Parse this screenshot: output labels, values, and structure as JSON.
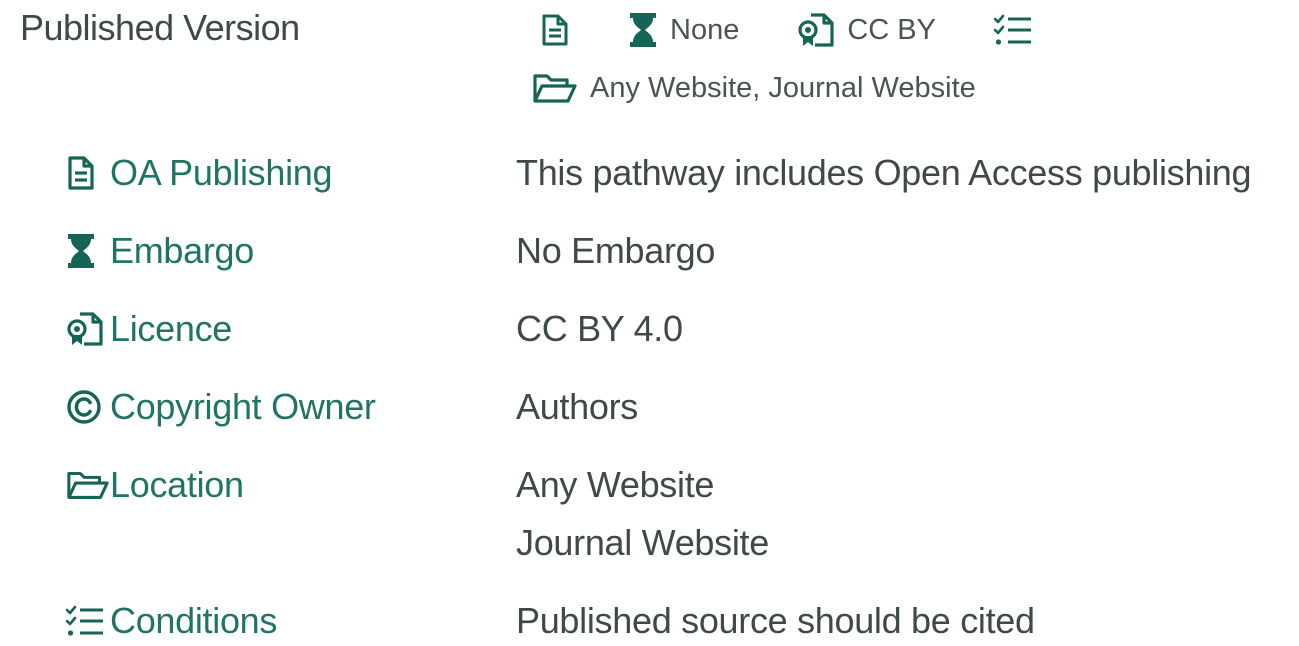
{
  "title": "Published Version",
  "summary": {
    "embargo": "None",
    "licence": "CC BY",
    "location": "Any Website, Journal Website"
  },
  "details": {
    "oa_publishing": {
      "label": "OA Publishing",
      "icon": "document-icon",
      "value": "This pathway includes Open Access publishing"
    },
    "embargo": {
      "label": "Embargo",
      "icon": "hourglass-icon",
      "value": "No Embargo"
    },
    "licence": {
      "label": "Licence",
      "icon": "certificate-icon",
      "value": "CC BY 4.0"
    },
    "copyright": {
      "label": "Copyright Owner",
      "icon": "copyright-icon",
      "value": "Authors"
    },
    "location": {
      "label": "Location",
      "icon": "folder-open-icon",
      "values": [
        "Any Website",
        "Journal Website"
      ]
    },
    "conditions": {
      "label": "Conditions",
      "icon": "checklist-icon",
      "value": "Published source should be cited"
    }
  },
  "colors": {
    "icon": "#156556",
    "label": "#1f7465",
    "text": "#3f4947"
  }
}
